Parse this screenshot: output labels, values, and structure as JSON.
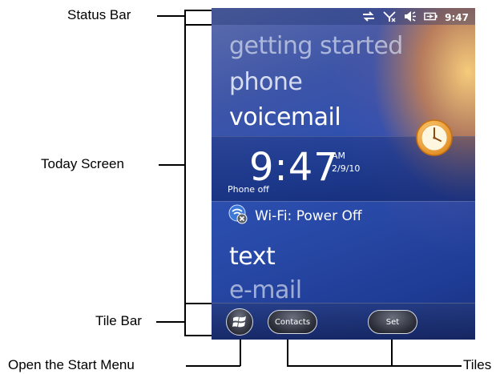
{
  "callouts": {
    "status_bar": "Status Bar",
    "today_screen": "Today Screen",
    "tile_bar": "Tile Bar",
    "open_start_menu": "Open the Start Menu",
    "tiles": "Tiles"
  },
  "status": {
    "time": "9:47",
    "icons": [
      "sync-icon",
      "no-signal-icon",
      "speaker-icon",
      "battery-icon"
    ]
  },
  "menu": {
    "items": [
      "getting started",
      "phone",
      "voicemail"
    ],
    "lower_items": [
      "text",
      "e-mail"
    ]
  },
  "today": {
    "time": "9:47",
    "ampm": "AM",
    "date": "2/9/10",
    "phone_status": "Phone off"
  },
  "wifi": {
    "label": "Wi-Fi: Power Off"
  },
  "tilebar": {
    "contacts": "Contacts",
    "set": "Set"
  },
  "colors": {
    "accent_orange": "#f0a030",
    "screen_blue": "#2747a4"
  }
}
